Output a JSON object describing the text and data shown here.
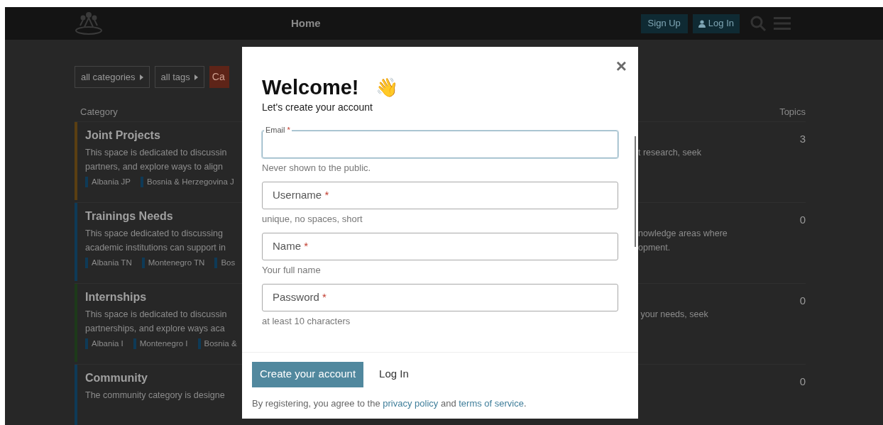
{
  "header": {
    "title": "Home",
    "sign_up": "Sign Up",
    "log_in": "Log In"
  },
  "filters": [
    "all categories",
    "all tags"
  ],
  "create_button": "Ca",
  "table": {
    "columns": [
      "Category",
      "Topics"
    ],
    "rows": [
      {
        "title": "Joint Projects",
        "color": "#5a3f12",
        "description_left": [
          "This space is dedicated to discussin",
          "partners, and explore ways to align"
        ],
        "description_right": [
          "t research, seek"
        ],
        "tags": [
          {
            "label": "Albania JP",
            "color": "#0e3a57"
          },
          {
            "label": "Bosnia & Herzegovina J",
            "color": "#0e3a57"
          }
        ],
        "topics": "3"
      },
      {
        "title": "Trainings Needs",
        "color": "#0e3a57",
        "description_left": [
          "This space dedicated to discussing",
          "academic institutions can support in"
        ],
        "description_right": [
          "nowledge areas where",
          "opment."
        ],
        "tags": [
          {
            "label": "Albania TN",
            "color": "#0e3a57"
          },
          {
            "label": "Montenegro TN",
            "color": "#0e3a57"
          },
          {
            "label": "Bos",
            "color": "#0e3a57"
          }
        ],
        "topics": "0"
      },
      {
        "title": "Internships",
        "color": "#1d3a1a",
        "description_left": [
          "This space is dedicated to discussin",
          "partnerships, and explore ways aca"
        ],
        "description_right": [
          " your needs, seek"
        ],
        "tags": [
          {
            "label": "Albania I",
            "color": "#0e3a57"
          },
          {
            "label": "Montenegro I",
            "color": "#0e3a57"
          },
          {
            "label": "Bosnia &",
            "color": "#0e3a57"
          }
        ],
        "topics": "0"
      },
      {
        "title": "Community",
        "color": "#0e3a57",
        "description_left": [
          "The community category is designe"
        ],
        "description_right": [],
        "tags": [],
        "topics": "0"
      }
    ]
  },
  "modal": {
    "close": "×",
    "title": "Welcome!",
    "emoji": "👋",
    "subtitle": "Let's create your account",
    "fields": [
      {
        "label": "Email",
        "required_mark": "*",
        "focused": true,
        "hint": "Never shown to the public."
      },
      {
        "label": "Username",
        "required_mark": "*",
        "focused": false,
        "hint": "unique, no spaces, short"
      },
      {
        "label": "Name",
        "required_mark": "*",
        "focused": false,
        "hint": "Your full name"
      },
      {
        "label": "Password",
        "required_mark": "*",
        "focused": false,
        "hint": "at least 10 characters"
      }
    ],
    "primary_button": "Create your account",
    "secondary_button": "Log In",
    "terms": {
      "before": "By registering, you agree to the ",
      "privacy_link": "privacy policy",
      "middle": " and ",
      "terms_link": "terms of service",
      "after": "."
    }
  }
}
